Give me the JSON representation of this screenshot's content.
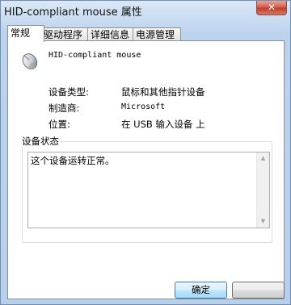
{
  "window": {
    "title": "HID-compliant mouse 属性",
    "close_glyph": "✕"
  },
  "tabs": [
    {
      "label": "常规",
      "active": true
    },
    {
      "label": "驱动程序",
      "active": false
    },
    {
      "label": "详细信息",
      "active": false
    },
    {
      "label": "电源管理",
      "active": false
    }
  ],
  "device": {
    "icon": "mouse-icon",
    "name": "HID-compliant mouse"
  },
  "properties": [
    {
      "label": "设备类型:",
      "value": "鼠标和其他指针设备"
    },
    {
      "label": "制造商:",
      "value": "Microsoft"
    },
    {
      "label": "位置:",
      "value": "在 USB 输入设备 上"
    }
  ],
  "status": {
    "group_title": "设备状态",
    "text": "这个设备运转正常。",
    "scroll_up_glyph": "▲",
    "scroll_down_glyph": "▼"
  },
  "buttons": {
    "ok_label": "确定",
    "cancel_label": ""
  }
}
